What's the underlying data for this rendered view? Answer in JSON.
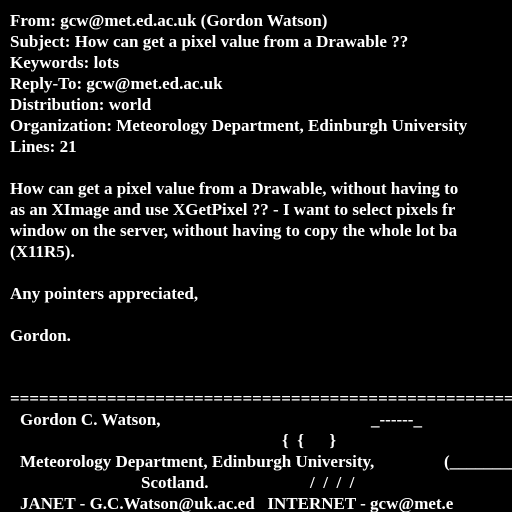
{
  "headers": {
    "from": "From: gcw@met.ed.ac.uk (Gordon Watson)",
    "subject": "Subject: How can get a pixel value from a Drawable ??",
    "keywords": "Keywords: lots",
    "reply_to": "Reply-To: gcw@met.ed.ac.uk",
    "distribution": "Distribution: world",
    "organization": "Organization: Meteorology Department, Edinburgh University",
    "lines": "Lines: 21"
  },
  "body": {
    "paragraph_lines": [
      "How can get a pixel value from a Drawable, without having to",
      "as an XImage and use XGetPixel ?? - I want to select pixels fr",
      "window on the server, without having to copy the whole lot ba",
      "(X11R5)."
    ],
    "closing": "Any pointers appreciated,",
    "sign_off": "Gordon."
  },
  "signature": {
    "rule": "==================================================================",
    "name": "Gordon C. Watson,",
    "art_1": "_------_",
    "art_2": "{  {      }",
    "org": "Meteorology Department, Edinburgh University,",
    "art_3": "(________",
    "country": "Scotland.",
    "art_4": "/  /  /  /",
    "contact": "JANET - G.C.Watson@uk.ac.ed   INTERNET - gcw@met.e"
  }
}
